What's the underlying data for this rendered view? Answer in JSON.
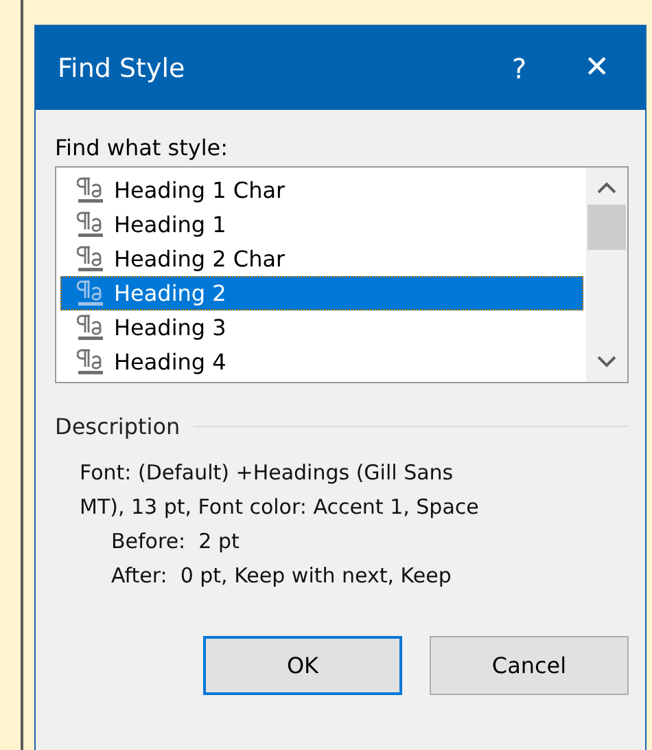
{
  "window": {
    "title": "Find Style",
    "help_glyph": "?",
    "close_glyph": "✕"
  },
  "style_label": "Find what style:",
  "styles": [
    {
      "name": "Heading 1 Char",
      "selected": false
    },
    {
      "name": "Heading 1",
      "selected": false
    },
    {
      "name": "Heading 2 Char",
      "selected": false
    },
    {
      "name": "Heading 2",
      "selected": true
    },
    {
      "name": "Heading 3",
      "selected": false
    },
    {
      "name": "Heading 4",
      "selected": false
    }
  ],
  "description": {
    "title": "Description",
    "lines": [
      {
        "text": "Font: (Default) +Headings (Gill Sans",
        "indented": false
      },
      {
        "text": "MT), 13 pt, Font color: Accent 1, Space",
        "indented": false
      },
      {
        "text": "Before:  2 pt",
        "indented": true
      },
      {
        "text": "After:  0 pt, Keep with next, Keep",
        "indented": true
      }
    ]
  },
  "buttons": [
    {
      "label": "OK",
      "default": true
    },
    {
      "label": "Cancel",
      "default": false
    }
  ]
}
